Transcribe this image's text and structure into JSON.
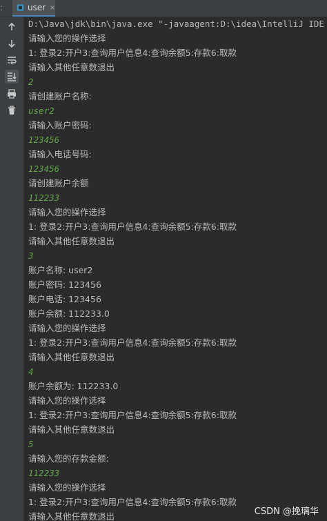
{
  "tab": {
    "prefix": ":",
    "label": "user"
  },
  "icons": [
    "up-arrow-icon",
    "down-arrow-icon",
    "soft-wrap-icon",
    "scroll-to-end-icon",
    "print-icon",
    "trash-icon"
  ],
  "console_lines": [
    {
      "text": "D:\\Java\\jdk\\bin\\java.exe \"-javaagent:D:\\idea\\IntelliJ IDE",
      "kind": "output"
    },
    {
      "text": "请输入您的操作选择",
      "kind": "output"
    },
    {
      "text": "1: 登录2:开户3:查询用户信息4:查询余额5:存款6:取款",
      "kind": "output"
    },
    {
      "text": "请输入其他任意数退出",
      "kind": "output"
    },
    {
      "text": "2",
      "kind": "input"
    },
    {
      "text": "请创建账户名称:",
      "kind": "output"
    },
    {
      "text": "user2",
      "kind": "input"
    },
    {
      "text": "请输入账户密码:",
      "kind": "output"
    },
    {
      "text": "123456",
      "kind": "input"
    },
    {
      "text": "请输入电话号码:",
      "kind": "output"
    },
    {
      "text": "123456",
      "kind": "input"
    },
    {
      "text": "请创建账户余额",
      "kind": "output"
    },
    {
      "text": "112233",
      "kind": "input"
    },
    {
      "text": "请输入您的操作选择",
      "kind": "output"
    },
    {
      "text": "1: 登录2:开户3:查询用户信息4:查询余额5:存款6:取款",
      "kind": "output"
    },
    {
      "text": "请输入其他任意数退出",
      "kind": "output"
    },
    {
      "text": "3",
      "kind": "input"
    },
    {
      "text": "账户名称: user2",
      "kind": "output"
    },
    {
      "text": "账户密码: 123456",
      "kind": "output"
    },
    {
      "text": "账户电话: 123456",
      "kind": "output"
    },
    {
      "text": "账户余额: 112233.0",
      "kind": "output"
    },
    {
      "text": "请输入您的操作选择",
      "kind": "output"
    },
    {
      "text": "1: 登录2:开户3:查询用户信息4:查询余额5:存款6:取款",
      "kind": "output"
    },
    {
      "text": "请输入其他任意数退出",
      "kind": "output"
    },
    {
      "text": "4",
      "kind": "input"
    },
    {
      "text": "账户余额为: 112233.0",
      "kind": "output"
    },
    {
      "text": "请输入您的操作选择",
      "kind": "output"
    },
    {
      "text": "1: 登录2:开户3:查询用户信息4:查询余额5:存款6:取款",
      "kind": "output"
    },
    {
      "text": "请输入其他任意数退出",
      "kind": "output"
    },
    {
      "text": "5",
      "kind": "input"
    },
    {
      "text": "请输入您的存款金额:",
      "kind": "output"
    },
    {
      "text": "112233",
      "kind": "input"
    },
    {
      "text": "请输入您的操作选择",
      "kind": "output"
    },
    {
      "text": "1: 登录2:开户3:查询用户信息4:查询余额5:存款6:取款",
      "kind": "output"
    },
    {
      "text": "请输入其他任意数退出",
      "kind": "output"
    }
  ],
  "watermark": "CSDN @挽璃华",
  "colors": {
    "background": "#2b2b2b",
    "output_text": "#bbbbbb",
    "input_text": "#62a64a",
    "toolbar": "#3c3f41"
  }
}
